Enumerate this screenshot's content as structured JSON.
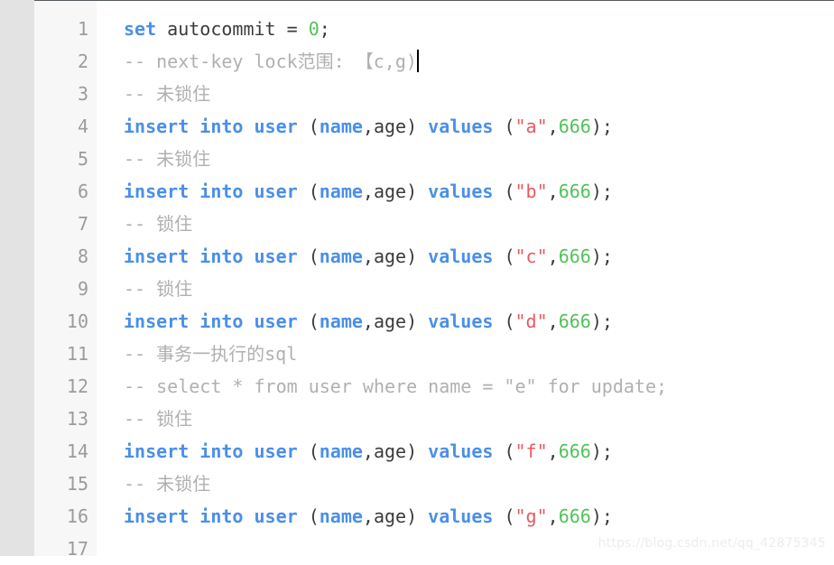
{
  "editor": {
    "language": "sql",
    "gutter_background": "#f7f7f7",
    "left_strip_background": "#e3e3e3",
    "code_background": "#ffffff",
    "colors": {
      "keyword": "#4a8fe8",
      "string": "#e8595e",
      "number": "#54c15a",
      "comment": "#b0b0b0",
      "plain": "#3b3b3b",
      "line_number": "#9b9b9b",
      "caret": "#000000",
      "watermark": "#ededed"
    },
    "line_numbers": [
      "1",
      "2",
      "3",
      "4",
      "5",
      "6",
      "7",
      "8",
      "9",
      "10",
      "11",
      "12",
      "13",
      "14",
      "15",
      "16",
      "17"
    ],
    "lines": [
      {
        "number": "1",
        "tokens": [
          {
            "t": "set",
            "k": "kw"
          },
          {
            "t": " autocommit = ",
            "k": "plain"
          },
          {
            "t": "0",
            "k": "num"
          },
          {
            "t": ";",
            "k": "plain"
          }
        ],
        "caret": false
      },
      {
        "number": "2",
        "tokens": [
          {
            "t": "-- next-key lock范围: 【c,g)",
            "k": "comment"
          }
        ],
        "caret": true
      },
      {
        "number": "3",
        "tokens": [
          {
            "t": "-- 未锁住",
            "k": "comment"
          }
        ],
        "caret": false
      },
      {
        "number": "4",
        "tokens": [
          {
            "t": "insert into user",
            "k": "kw"
          },
          {
            "t": " (",
            "k": "plain"
          },
          {
            "t": "name",
            "k": "kw"
          },
          {
            "t": ",age) ",
            "k": "plain"
          },
          {
            "t": "values",
            "k": "kw"
          },
          {
            "t": " (",
            "k": "plain"
          },
          {
            "t": "\"a\"",
            "k": "str"
          },
          {
            "t": ",",
            "k": "plain"
          },
          {
            "t": "666",
            "k": "num"
          },
          {
            "t": ");",
            "k": "plain"
          }
        ],
        "caret": false
      },
      {
        "number": "5",
        "tokens": [
          {
            "t": "-- 未锁住",
            "k": "comment"
          }
        ],
        "caret": false
      },
      {
        "number": "6",
        "tokens": [
          {
            "t": "insert into user",
            "k": "kw"
          },
          {
            "t": " (",
            "k": "plain"
          },
          {
            "t": "name",
            "k": "kw"
          },
          {
            "t": ",age) ",
            "k": "plain"
          },
          {
            "t": "values",
            "k": "kw"
          },
          {
            "t": " (",
            "k": "plain"
          },
          {
            "t": "\"b\"",
            "k": "str"
          },
          {
            "t": ",",
            "k": "plain"
          },
          {
            "t": "666",
            "k": "num"
          },
          {
            "t": ");",
            "k": "plain"
          }
        ],
        "caret": false
      },
      {
        "number": "7",
        "tokens": [
          {
            "t": "-- 锁住",
            "k": "comment"
          }
        ],
        "caret": false
      },
      {
        "number": "8",
        "tokens": [
          {
            "t": "insert into user",
            "k": "kw"
          },
          {
            "t": " (",
            "k": "plain"
          },
          {
            "t": "name",
            "k": "kw"
          },
          {
            "t": ",age) ",
            "k": "plain"
          },
          {
            "t": "values",
            "k": "kw"
          },
          {
            "t": " (",
            "k": "plain"
          },
          {
            "t": "\"c\"",
            "k": "str"
          },
          {
            "t": ",",
            "k": "plain"
          },
          {
            "t": "666",
            "k": "num"
          },
          {
            "t": ");",
            "k": "plain"
          }
        ],
        "caret": false
      },
      {
        "number": "9",
        "tokens": [
          {
            "t": "-- 锁住",
            "k": "comment"
          }
        ],
        "caret": false
      },
      {
        "number": "10",
        "tokens": [
          {
            "t": "insert into user",
            "k": "kw"
          },
          {
            "t": " (",
            "k": "plain"
          },
          {
            "t": "name",
            "k": "kw"
          },
          {
            "t": ",age) ",
            "k": "plain"
          },
          {
            "t": "values",
            "k": "kw"
          },
          {
            "t": " (",
            "k": "plain"
          },
          {
            "t": "\"d\"",
            "k": "str"
          },
          {
            "t": ",",
            "k": "plain"
          },
          {
            "t": "666",
            "k": "num"
          },
          {
            "t": ");",
            "k": "plain"
          }
        ],
        "caret": false
      },
      {
        "number": "11",
        "tokens": [
          {
            "t": "-- 事务一执行的sql",
            "k": "comment"
          }
        ],
        "caret": false
      },
      {
        "number": "12",
        "tokens": [
          {
            "t": "-- select * from user where name = \"e\" for update;",
            "k": "comment"
          }
        ],
        "caret": false
      },
      {
        "number": "13",
        "tokens": [
          {
            "t": "-- 锁住",
            "k": "comment"
          }
        ],
        "caret": false
      },
      {
        "number": "14",
        "tokens": [
          {
            "t": "insert into user",
            "k": "kw"
          },
          {
            "t": " (",
            "k": "plain"
          },
          {
            "t": "name",
            "k": "kw"
          },
          {
            "t": ",age) ",
            "k": "plain"
          },
          {
            "t": "values",
            "k": "kw"
          },
          {
            "t": " (",
            "k": "plain"
          },
          {
            "t": "\"f\"",
            "k": "str"
          },
          {
            "t": ",",
            "k": "plain"
          },
          {
            "t": "666",
            "k": "num"
          },
          {
            "t": ");",
            "k": "plain"
          }
        ],
        "caret": false
      },
      {
        "number": "15",
        "tokens": [
          {
            "t": "-- 未锁住",
            "k": "comment"
          }
        ],
        "caret": false
      },
      {
        "number": "16",
        "tokens": [
          {
            "t": "insert into user",
            "k": "kw"
          },
          {
            "t": " (",
            "k": "plain"
          },
          {
            "t": "name",
            "k": "kw"
          },
          {
            "t": ",age) ",
            "k": "plain"
          },
          {
            "t": "values",
            "k": "kw"
          },
          {
            "t": " (",
            "k": "plain"
          },
          {
            "t": "\"g\"",
            "k": "str"
          },
          {
            "t": ",",
            "k": "plain"
          },
          {
            "t": "666",
            "k": "num"
          },
          {
            "t": ");",
            "k": "plain"
          }
        ],
        "caret": false
      },
      {
        "number": "17",
        "tokens": [],
        "caret": false
      }
    ]
  },
  "watermark": {
    "text": "https://blog.csdn.net/qq_42875345"
  }
}
